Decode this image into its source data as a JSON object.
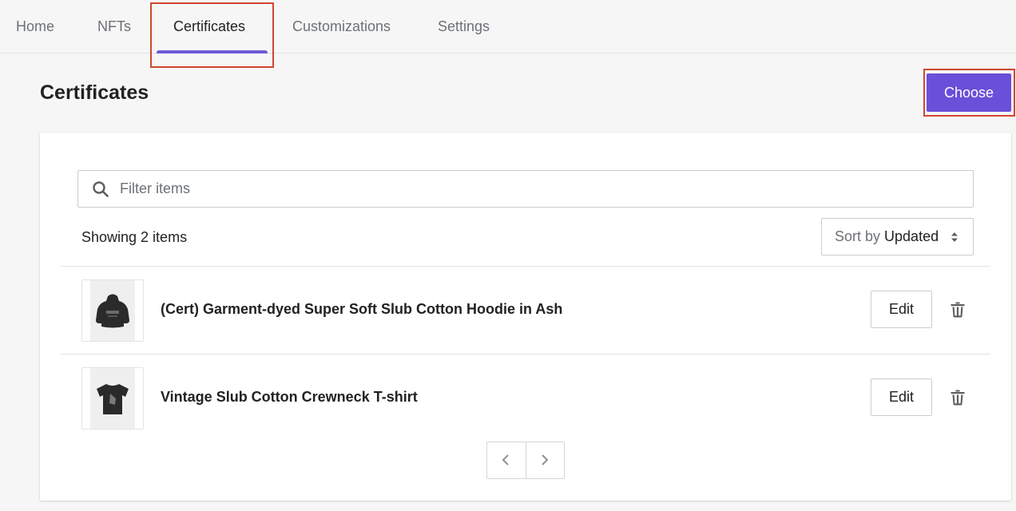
{
  "nav": {
    "tabs": [
      {
        "label": "Home",
        "active": false
      },
      {
        "label": "NFTs",
        "active": false
      },
      {
        "label": "Certificates",
        "active": true
      },
      {
        "label": "Customizations",
        "active": false
      },
      {
        "label": "Settings",
        "active": false
      }
    ]
  },
  "header": {
    "title": "Certificates",
    "primary_action": "Choose"
  },
  "filter": {
    "placeholder": "Filter items",
    "value": "",
    "icon": "search-icon"
  },
  "list": {
    "count_text": "Showing 2 items",
    "sort": {
      "label": "Sort by",
      "value": "Updated",
      "icon": "sort-arrows-icon"
    },
    "items": [
      {
        "title": "(Cert) Garment-dyed Super Soft Slub Cotton Hoodie in Ash",
        "thumbnail": "hoodie-image",
        "edit_label": "Edit",
        "delete_icon": "trash-icon"
      },
      {
        "title": "Vintage Slub Cotton Crewneck T-shirt",
        "thumbnail": "tshirt-image",
        "edit_label": "Edit",
        "delete_icon": "trash-icon"
      }
    ]
  },
  "pagination": {
    "prev_icon": "chevron-left-icon",
    "next_icon": "chevron-right-icon"
  },
  "colors": {
    "accent": "#6a4fd8",
    "tab_underline": "#6c5bd4",
    "annotation_highlight": "#d0472f"
  }
}
